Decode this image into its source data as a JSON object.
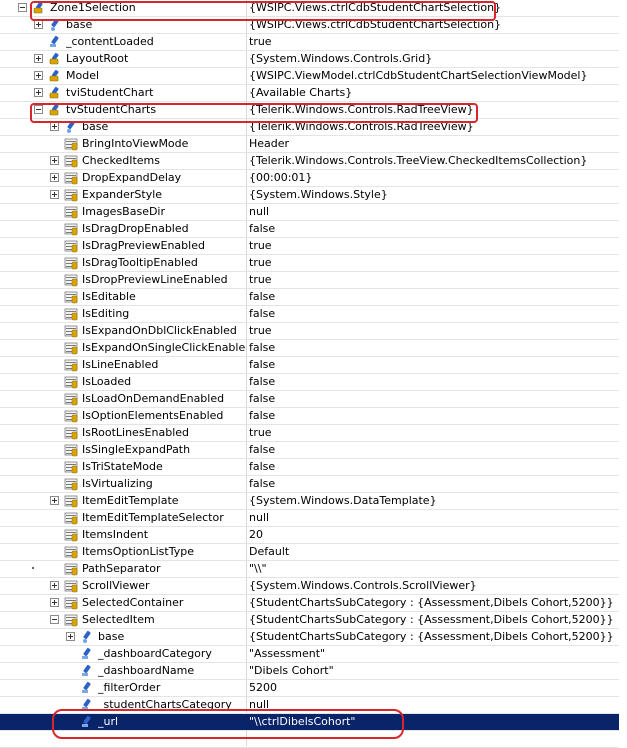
{
  "rows": [
    {
      "name": "Zone1Selection",
      "value": "{WSIPC.Views.ctrlCdbStudentChartSelection}",
      "icon": "object-icon",
      "expander": "minus"
    },
    {
      "name": "base",
      "value": "{WSIPC.Views.ctrlCdbStudentChartSelection}",
      "icon": "base-icon",
      "expander": "plus"
    },
    {
      "name": "_contentLoaded",
      "value": "true",
      "icon": "field-icon",
      "expander": ""
    },
    {
      "name": "LayoutRoot",
      "value": "{System.Windows.Controls.Grid}",
      "icon": "object-icon",
      "expander": "plus"
    },
    {
      "name": "Model",
      "value": "{WSIPC.ViewModel.ctrlCdbStudentChartSelectionViewModel}",
      "icon": "object-icon",
      "expander": "plus"
    },
    {
      "name": "tviStudentChart",
      "value": "{Available Charts}",
      "icon": "object-icon",
      "expander": "plus"
    },
    {
      "name": "tvStudentCharts",
      "value": "{Telerik.Windows.Controls.RadTreeView}",
      "icon": "object-icon",
      "expander": "minus"
    },
    {
      "name": "base",
      "value": "{Telerik.Windows.Controls.RadTreeView}",
      "icon": "base-icon",
      "expander": "plus"
    },
    {
      "name": "BringIntoViewMode",
      "value": "Header",
      "icon": "property-icon",
      "expander": ""
    },
    {
      "name": "CheckedItems",
      "value": "{Telerik.Windows.Controls.TreeView.CheckedItemsCollection}",
      "icon": "property-icon",
      "expander": "plus"
    },
    {
      "name": "DropExpandDelay",
      "value": "{00:00:01}",
      "icon": "property-icon",
      "expander": "plus"
    },
    {
      "name": "ExpanderStyle",
      "value": "{System.Windows.Style}",
      "icon": "property-icon",
      "expander": "plus"
    },
    {
      "name": "ImagesBaseDir",
      "value": "null",
      "icon": "property-icon",
      "expander": ""
    },
    {
      "name": "IsDragDropEnabled",
      "value": "false",
      "icon": "property-icon",
      "expander": ""
    },
    {
      "name": "IsDragPreviewEnabled",
      "value": "true",
      "icon": "property-icon",
      "expander": ""
    },
    {
      "name": "IsDragTooltipEnabled",
      "value": "true",
      "icon": "property-icon",
      "expander": ""
    },
    {
      "name": "IsDropPreviewLineEnabled",
      "value": "true",
      "icon": "property-icon",
      "expander": ""
    },
    {
      "name": "IsEditable",
      "value": "false",
      "icon": "property-icon",
      "expander": ""
    },
    {
      "name": "IsEditing",
      "value": "false",
      "icon": "property-icon",
      "expander": ""
    },
    {
      "name": "IsExpandOnDblClickEnabled",
      "value": "true",
      "icon": "property-icon",
      "expander": ""
    },
    {
      "name": "IsExpandOnSingleClickEnabled",
      "value": "false",
      "icon": "property-icon",
      "expander": ""
    },
    {
      "name": "IsLineEnabled",
      "value": "false",
      "icon": "property-icon",
      "expander": ""
    },
    {
      "name": "IsLoaded",
      "value": "false",
      "icon": "property-icon",
      "expander": ""
    },
    {
      "name": "IsLoadOnDemandEnabled",
      "value": "false",
      "icon": "property-icon",
      "expander": ""
    },
    {
      "name": "IsOptionElementsEnabled",
      "value": "false",
      "icon": "property-icon",
      "expander": ""
    },
    {
      "name": "IsRootLinesEnabled",
      "value": "true",
      "icon": "property-icon",
      "expander": ""
    },
    {
      "name": "IsSingleExpandPath",
      "value": "false",
      "icon": "property-icon",
      "expander": ""
    },
    {
      "name": "IsTriStateMode",
      "value": "false",
      "icon": "property-icon",
      "expander": ""
    },
    {
      "name": "IsVirtualizing",
      "value": "false",
      "icon": "property-icon",
      "expander": ""
    },
    {
      "name": "ItemEditTemplate",
      "value": "{System.Windows.DataTemplate}",
      "icon": "property-icon",
      "expander": "plus"
    },
    {
      "name": "ItemEditTemplateSelector",
      "value": "null",
      "icon": "property-icon",
      "expander": ""
    },
    {
      "name": "ItemsIndent",
      "value": "20",
      "icon": "property-icon",
      "expander": ""
    },
    {
      "name": "ItemsOptionListType",
      "value": "Default",
      "icon": "property-icon",
      "expander": ""
    },
    {
      "name": "PathSeparator",
      "value": "\"\\\\\"",
      "icon": "property-icon",
      "expander": ""
    },
    {
      "name": "ScrollViewer",
      "value": "{System.Windows.Controls.ScrollViewer}",
      "icon": "property-icon",
      "expander": "plus"
    },
    {
      "name": "SelectedContainer",
      "value": "{StudentChartsSubCategory : {Assessment,Dibels Cohort,5200}}",
      "icon": "property-icon",
      "expander": "plus"
    },
    {
      "name": "SelectedItem",
      "value": "{StudentChartsSubCategory : {Assessment,Dibels Cohort,5200}}",
      "icon": "property-icon",
      "expander": "minus"
    },
    {
      "name": "base",
      "value": "{StudentChartsSubCategory : {Assessment,Dibels Cohort,5200}}",
      "icon": "base-icon",
      "expander": "plus"
    },
    {
      "name": "_dashboardCategory",
      "value": "\"Assessment\"",
      "icon": "field-icon",
      "expander": ""
    },
    {
      "name": "_dashboardName",
      "value": "\"Dibels Cohort\"",
      "icon": "field-icon",
      "expander": ""
    },
    {
      "name": "_filterOrder",
      "value": "5200",
      "icon": "field-icon",
      "expander": ""
    },
    {
      "name": "_studentChartsCategory",
      "value": "null",
      "icon": "field-icon",
      "expander": ""
    },
    {
      "name": "_url",
      "value": "\"\\\\ctrlDibelsCohort\"",
      "icon": "field-icon",
      "expander": "",
      "selected": true
    },
    {
      "name": "",
      "value": "",
      "icon": "",
      "expander": ""
    }
  ]
}
